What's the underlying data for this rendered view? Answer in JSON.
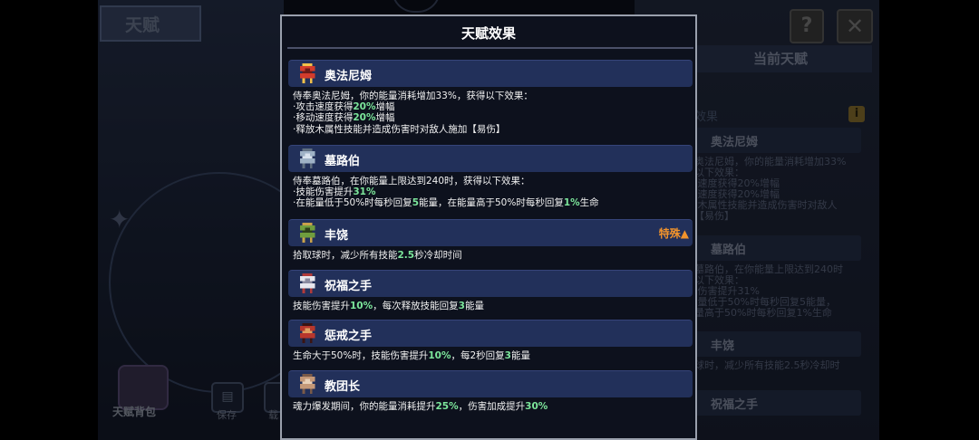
{
  "background": {
    "left_tab_label": "天赋",
    "bag_label": "天赋背包",
    "save_label": "保存",
    "load_label": "载",
    "help_label": "?",
    "close_label": "✕",
    "current_panel_title": "当前天赋",
    "current_section_label": "天赋效果",
    "current_info_badge": "i",
    "current_items": [
      {
        "name": "奥法尼姆",
        "lines": [
          "侍奉奥法尼姆，你的能量消耗增加33%",
          "获得以下效果：",
          "·攻击速度获得20%增幅",
          "·移动速度获得20%增幅",
          "·释放木属性技能并造成伤害时对敌人",
          "施加【易伤】"
        ]
      },
      {
        "name": "墓路伯",
        "lines": [
          "侍奉墓路伯，在你能量上限达到240时",
          "获得以下效果：",
          "·技能伤害提升31%",
          "·在能量低于50%时每秒回复5能量，",
          "在能量高于50%时每秒回复1%生命"
        ]
      },
      {
        "name": "丰饶",
        "lines": [
          "拾取球时，减少所有技能2.5秒冷却时"
        ]
      },
      {
        "name": "祝福之手",
        "lines": []
      }
    ]
  },
  "modal": {
    "title": "天赋效果",
    "talents": [
      {
        "name": "奥法尼姆",
        "icon": "red-armored-knight-icon",
        "special": "",
        "lines": [
          {
            "segs": [
              {
                "t": "侍奉奥法尼姆，你的能量消耗增加33%，获得以下效果：",
                "h": false
              }
            ]
          },
          {
            "segs": [
              {
                "t": "·攻击速度获得",
                "h": false
              },
              {
                "t": "20%",
                "h": true
              },
              {
                "t": "增幅",
                "h": false
              }
            ]
          },
          {
            "segs": [
              {
                "t": "·移动速度获得",
                "h": false
              },
              {
                "t": "20%",
                "h": true
              },
              {
                "t": "增幅",
                "h": false
              }
            ]
          },
          {
            "segs": [
              {
                "t": "·释放木属性技能并造成伤害时对敌人施加【易伤】",
                "h": false
              }
            ]
          }
        ]
      },
      {
        "name": "墓路伯",
        "icon": "stone-tomb-guardian-icon",
        "special": "",
        "lines": [
          {
            "segs": [
              {
                "t": "侍奉墓路伯，在你能量上限达到240时，获得以下效果：",
                "h": false
              }
            ]
          },
          {
            "segs": [
              {
                "t": "·技能伤害提升",
                "h": false
              },
              {
                "t": "31%",
                "h": true
              }
            ]
          },
          {
            "segs": [
              {
                "t": "·在能量低于50%时每秒回复",
                "h": false
              },
              {
                "t": "5",
                "h": true
              },
              {
                "t": "能量，在能量高于50%时每秒回复",
                "h": false
              },
              {
                "t": "1%",
                "h": true
              },
              {
                "t": "生命",
                "h": false
              }
            ]
          }
        ]
      },
      {
        "name": "丰饶",
        "icon": "green-horned-mask-icon",
        "special": "特殊▲",
        "lines": [
          {
            "segs": [
              {
                "t": "拾取球时，减少所有技能",
                "h": false
              },
              {
                "t": "2.5",
                "h": true
              },
              {
                "t": "秒冷却时间",
                "h": false
              }
            ]
          }
        ]
      },
      {
        "name": "祝福之手",
        "icon": "blessing-hand-icon",
        "special": "",
        "lines": [
          {
            "segs": [
              {
                "t": "技能伤害提升",
                "h": false
              },
              {
                "t": "10%",
                "h": true
              },
              {
                "t": "，每次释放技能回复",
                "h": false
              },
              {
                "t": "3",
                "h": true
              },
              {
                "t": "能量",
                "h": false
              }
            ]
          }
        ]
      },
      {
        "name": "惩戒之手",
        "icon": "punishing-hand-icon",
        "special": "",
        "lines": [
          {
            "segs": [
              {
                "t": "生命大于50%时，技能伤害提升",
                "h": false
              },
              {
                "t": "10%",
                "h": true
              },
              {
                "t": "，每2秒回复",
                "h": false
              },
              {
                "t": "3",
                "h": true
              },
              {
                "t": "能量",
                "h": false
              }
            ]
          }
        ]
      },
      {
        "name": "教团长",
        "icon": "cult-leader-icon",
        "special": "",
        "lines": [
          {
            "segs": [
              {
                "t": "魂力爆发期间，你的能量消耗提升",
                "h": false
              },
              {
                "t": "25%",
                "h": true
              },
              {
                "t": "，伤害加成提升",
                "h": false
              },
              {
                "t": "30%",
                "h": true
              }
            ]
          }
        ]
      }
    ]
  },
  "colors": {
    "highlight": "#7ce69b",
    "special": "#f1932c",
    "bar": "#22305a"
  }
}
